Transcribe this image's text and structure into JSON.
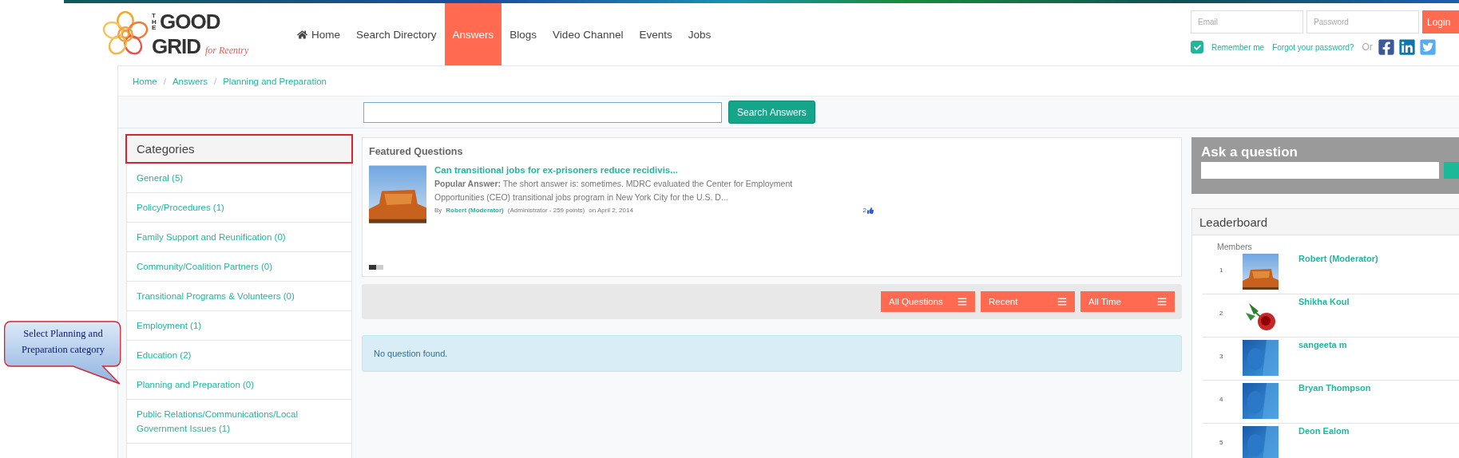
{
  "logo": {
    "the": "THE",
    "good": "GOOD",
    "grid": "GRID",
    "tagline": "for Reentry"
  },
  "nav": [
    {
      "label": "Home",
      "selected": false
    },
    {
      "label": "Search Directory",
      "selected": false
    },
    {
      "label": "Answers",
      "selected": true
    },
    {
      "label": "Blogs",
      "selected": false
    },
    {
      "label": "Video Channel",
      "selected": false
    },
    {
      "label": "Events",
      "selected": false
    },
    {
      "label": "Jobs",
      "selected": false
    }
  ],
  "login": {
    "email_placeholder": "Email",
    "password_placeholder": "Password",
    "button": "Login",
    "remember": {
      "label": "Remember me",
      "checked": true
    },
    "forgot": "Forgot your password?",
    "or": "Or"
  },
  "breadcrumb": {
    "separator": "/",
    "items": [
      "Home",
      "Answers",
      "Planning and Preparation"
    ]
  },
  "search": {
    "button": "Search Answers"
  },
  "categories": {
    "title": "Categories",
    "highlighted": true,
    "items": [
      {
        "label": "General (5)"
      },
      {
        "label": "Policy/Procedures (1)"
      },
      {
        "label": "Family Support and Reunification (0)"
      },
      {
        "label": "Community/Coalition Partners (0)"
      },
      {
        "label": "Transitional Programs & Volunteers (0)"
      },
      {
        "label": "Employment (1)"
      },
      {
        "label": "Education (2)"
      },
      {
        "label": "Planning and Preparation (0)"
      },
      {
        "label": "Public Relations/Communications/Local Government Issues (1)"
      }
    ]
  },
  "callout": {
    "text": "Select Planning and Preparation category"
  },
  "featured": {
    "title": "Featured Questions",
    "question": {
      "title": "Can transitional jobs for ex-prisoners reduce recidivis...",
      "answer": "**Popular Answer:** The short answer is: sometimes. MDRC evaluated the Center for Employment Opportunities (CEO) transitional jobs program in New York City for the U.S. D...",
      "by": "By",
      "author": "Robert (Moderator)",
      "role": "(Administrator - 259 points)",
      "date": "on April 2, 2014",
      "likes": "2"
    },
    "slides": [
      {
        "selected": true
      },
      {
        "selected": false
      }
    ]
  },
  "filters": [
    {
      "label": "All Questions"
    },
    {
      "label": "Recent"
    },
    {
      "label": "All Time"
    }
  ],
  "empty_message": "No question found.",
  "ask": {
    "title": "Ask a question"
  },
  "leaderboard": {
    "title": "Leaderboard",
    "subtitle": "Members",
    "members": [
      {
        "rank": "1",
        "name": "Robert (Moderator)"
      },
      {
        "rank": "2",
        "name": "Shikha Koul"
      },
      {
        "rank": "3",
        "name": "sangeeta m"
      },
      {
        "rank": "4",
        "name": "Bryan Thompson"
      },
      {
        "rank": "5",
        "name": "Deon Ealom"
      }
    ]
  }
}
